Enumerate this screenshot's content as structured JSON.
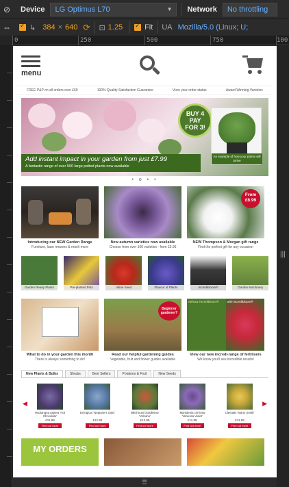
{
  "toolbar": {
    "device_label": "Device",
    "device_value": "LG Optimus L70",
    "network_label": "Network",
    "network_value": "No throttling",
    "width_value": "384",
    "height_value": "640",
    "times_sign": "×",
    "zoom_value": "1.25",
    "fit_label": "Fit",
    "ua_label": "UA",
    "ua_value": "Mozilla/5.0 (Linux; U;"
  },
  "ruler": {
    "marks": [
      "0",
      "250",
      "500",
      "750",
      "100"
    ]
  },
  "page": {
    "menu_label": "menu",
    "usp": [
      "FREE P&P on all orders over £60",
      "100% Quality Satisfaction Guarantee",
      "View your order status",
      "Award Winning Varieties"
    ],
    "hero": {
      "badge": [
        "BUY 4",
        "PAY",
        "FOR 3!"
      ],
      "headline": "Add instant impact in your garden from just £7.99",
      "subline": "A fantastic range of over 500 large potted plants now available",
      "pot_caption": "An example of how your plants will arrive"
    },
    "dots": "• o • •",
    "feature_cards": [
      {
        "title": "Introducing our NEW Garden Range",
        "sub": "Furniture, lawn mowers & much more"
      },
      {
        "title": "New autumn varieties now available",
        "sub": "Choose from over 100 varieties - from £5.99"
      },
      {
        "title": "NEW Thompson & Morgan gift range",
        "sub": "Find the perfect gift for any occasion",
        "badge_line1": "From",
        "badge_line2": "£6.99"
      }
    ],
    "categories": [
      "Garden Ready Plants",
      "Pre-planted Pots",
      "Value Seed",
      "Flavour of Plants",
      "Incredibloom®",
      "Garden Machinery"
    ],
    "info_cards": [
      {
        "title": "What to do in your garden this month",
        "sub": "There is always something to do!"
      },
      {
        "title": "Read our helpful gardening guides",
        "sub": "Vegetable, fruit and flower guides available",
        "badge": "Beginner gardener?"
      },
      {
        "title": "View our new incredi-range of fertilisers",
        "sub": "We know you'll see incredible results!",
        "img_labels": [
          "without incredibloom®",
          "with incredibloom®"
        ]
      }
    ],
    "tabs": [
      "New Plants & Bulbs",
      "Shrubs",
      "Best Sellers",
      "Potatoes & Fruit",
      "New Seeds"
    ],
    "products": [
      {
        "name": "Hydrangea aspera 'Hot Chocolate'",
        "price": "£11.99",
        "button": "Find out more"
      },
      {
        "name": "Eryngium 'Neptune's Gold'",
        "price": "£12.99",
        "button": "Find out more"
      },
      {
        "name": "Blechnum brasiliense 'Volcano'",
        "price": "£12.99",
        "button": "Find out more"
      },
      {
        "name": "Marsdenia cirrhosa 'Vanessa Violet'",
        "price": "£11.98",
        "button": "Find out more"
      },
      {
        "name": "Clematis 'Marry Smith'",
        "price": "£11.99",
        "button": "Find out more"
      }
    ],
    "my_orders": "MY ORDERS"
  },
  "colors": {
    "accent_red": "#c8102e",
    "orange": "#f0a020",
    "green": "#3b6a1e",
    "lime": "#9bc53d"
  }
}
